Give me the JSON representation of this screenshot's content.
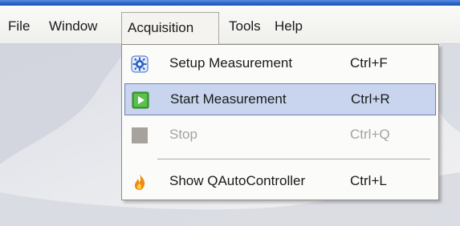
{
  "menubar": {
    "items": [
      {
        "label": "File"
      },
      {
        "label": "Window"
      },
      {
        "label": "Acquisition",
        "open": true
      },
      {
        "label": "Tools"
      },
      {
        "label": "Help"
      }
    ]
  },
  "dropdown": {
    "items": [
      {
        "label": "Setup Measurement",
        "shortcut": "Ctrl+F",
        "icon": "gear-icon",
        "enabled": true
      },
      {
        "label": "Start Measurement",
        "shortcut": "Ctrl+R",
        "icon": "play-icon",
        "enabled": true,
        "highlighted": true
      },
      {
        "label": "Stop",
        "shortcut": "Ctrl+Q",
        "icon": "stop-icon",
        "enabled": false
      },
      {
        "label": "Show QAutoController",
        "shortcut": "Ctrl+L",
        "icon": "flame-icon",
        "enabled": true
      }
    ]
  },
  "colors": {
    "title_bar": "#2b62c8",
    "highlight": "#c9d5ee",
    "highlight_border": "#6b7fb1",
    "disabled_text": "#a3a3a3",
    "play_icon": "#3fa535",
    "flame_icon": "#f08a10"
  }
}
